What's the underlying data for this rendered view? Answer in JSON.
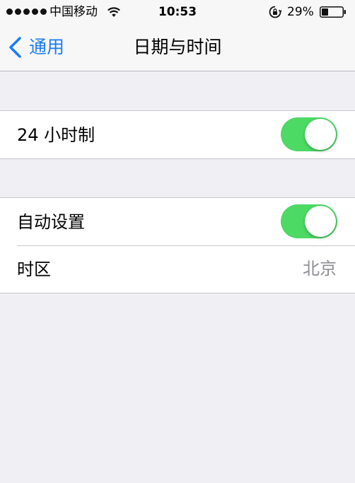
{
  "status_bar": {
    "carrier": "中国移动",
    "time": "10:53",
    "battery_percent": "29%",
    "icons": [
      "signal-dots",
      "wifi-icon",
      "rotation-lock-icon",
      "battery-icon"
    ]
  },
  "nav": {
    "back_label": "通用",
    "title": "日期与时间"
  },
  "settings": {
    "hour24": {
      "label": "24 小时制",
      "on": true
    },
    "auto_set": {
      "label": "自动设置",
      "on": true
    },
    "timezone": {
      "label": "时区",
      "value": "北京"
    }
  },
  "colors": {
    "accent": "#1a7cf2",
    "toggle_on": "#4cd964",
    "background": "#efeff4"
  }
}
